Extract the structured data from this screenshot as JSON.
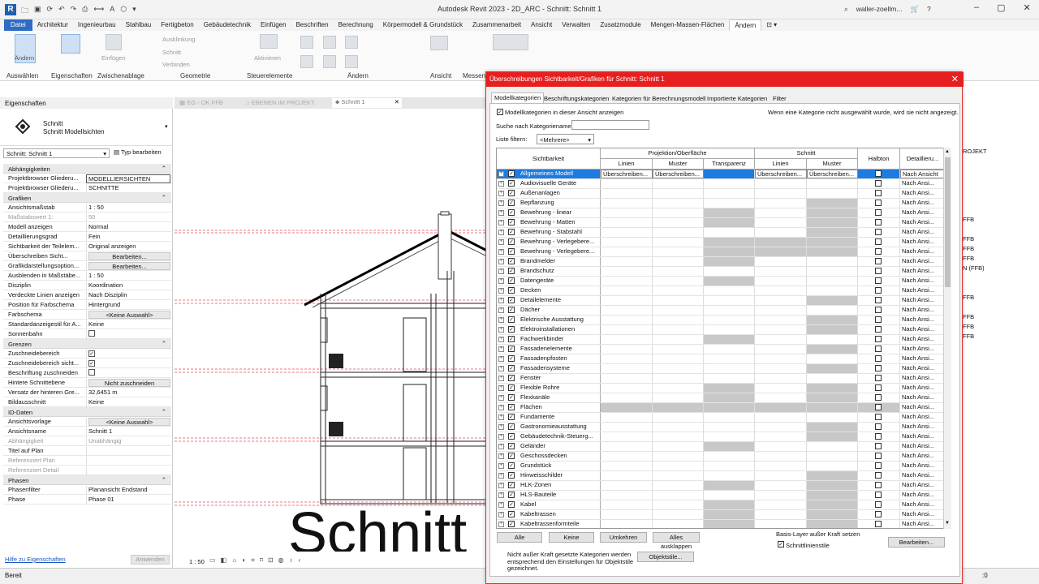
{
  "app": {
    "title": "Autodesk Revit 2023 - 2D_ARC - Schnitt: Schnitt 1",
    "user": "waller-zoellm...",
    "logo": "R"
  },
  "menu": [
    "Datei",
    "Architektur",
    "Ingenieurbau",
    "Stahlbau",
    "Fertigbeton",
    "Gebäudetechnik",
    "Einfügen",
    "Beschriften",
    "Berechnung",
    "Körpermodell & Grundstück",
    "Zusammenarbeit",
    "Ansicht",
    "Verwalten",
    "Zusatzmodule",
    "Mengen-Massen-Flächen",
    "Ändern"
  ],
  "ribbon": {
    "groups": [
      "Auswählen",
      "Eigenschaften",
      "Zwischenablage",
      "Geometrie",
      "Steuerelemente",
      "Ändern",
      "Ansicht",
      "Messen"
    ],
    "buttons": {
      "aendern": "Ändern",
      "einfuegen": "Einfügen",
      "ausklinkung": "Ausklinkung",
      "schnitt": "Schnitt",
      "verbinden": "Verbinden",
      "aktivieren": "Aktivieren"
    }
  },
  "properties": {
    "header": "Eigenschaften",
    "type_name": "Schnitt",
    "type_sub": "Schnitt Modellsichten",
    "instance": "Schnitt: Schnitt 1",
    "edit_type": "Typ bearbeiten",
    "help": "Hilfe zu Eigenschaften",
    "apply": "Anwenden",
    "sections": {
      "abh": "Abhängigkeiten",
      "grafiken": "Grafiken",
      "grenzen": "Grenzen",
      "iddaten": "ID-Daten",
      "phasen": "Phasen"
    },
    "rows": {
      "r1": {
        "k": "Projektbrowser Gliederu...",
        "v": "MODELLIERSICHTEN"
      },
      "r2": {
        "k": "Projektbrowser Gliederu...",
        "v": "SCHNITTE"
      },
      "r3": {
        "k": "Ansichtsmaßstab",
        "v": "1 : 50"
      },
      "r4": {
        "k": "Maßstabswert 1:",
        "v": "50"
      },
      "r5": {
        "k": "Modell anzeigen",
        "v": "Normal"
      },
      "r6": {
        "k": "Detaillierungsgrad",
        "v": "Fein"
      },
      "r7": {
        "k": "Sichtbarkeit der Teilelem...",
        "v": "Original anzeigen"
      },
      "r8": {
        "k": "Überschreiben Sicht...",
        "v": "Bearbeiten..."
      },
      "r9": {
        "k": "Grafikdarstellungsoption...",
        "v": "Bearbeiten..."
      },
      "r10": {
        "k": "Ausblenden in Maßstäbe...",
        "v": "1 : 50"
      },
      "r11": {
        "k": "Disziplin",
        "v": "Koordination"
      },
      "r12": {
        "k": "Verdeckte Linien anzeigen",
        "v": "Nach Disziplin"
      },
      "r13": {
        "k": "Position für Farbschema",
        "v": "Hintergrund"
      },
      "r14": {
        "k": "Farbschema",
        "v": "<Keine Auswahl>"
      },
      "r15": {
        "k": "Standardanzeigestil für A...",
        "v": "Keine"
      },
      "r16": {
        "k": "Sonnenbahn",
        "v": ""
      },
      "r17": {
        "k": "Zuschneidebereich",
        "v": "✓"
      },
      "r18": {
        "k": "Zuschneidebereich sicht...",
        "v": "✓"
      },
      "r19": {
        "k": "Beschriftung zuschneiden",
        "v": ""
      },
      "r20": {
        "k": "Hintere Schnittebene",
        "v": "Nicht zuschneiden"
      },
      "r21": {
        "k": "Versatz der hinteren Gre...",
        "v": "32,6451 m"
      },
      "r22": {
        "k": "Bildausschnitt",
        "v": "Keine"
      },
      "r23": {
        "k": "Ansichtsvorlage",
        "v": "<Keine Auswahl>"
      },
      "r24": {
        "k": "Ansichtsname",
        "v": "Schnitt 1"
      },
      "r25": {
        "k": "Abhängigkeit",
        "v": "Unabhängig"
      },
      "r26": {
        "k": "Titel auf Plan",
        "v": ""
      },
      "r27": {
        "k": "Referenziert Plan",
        "v": ""
      },
      "r28": {
        "k": "Referenziert Detail",
        "v": ""
      },
      "r29": {
        "k": "Phasenfilter",
        "v": "Planansicht Endstand"
      },
      "r30": {
        "k": "Phase",
        "v": "Phase 01"
      }
    }
  },
  "view_tabs": [
    "EG - OK FFB",
    "EBENEN IM PROJEKT",
    "Schnitt 1"
  ],
  "drawing": {
    "label": "Schnitt",
    "scale": "1 : 50"
  },
  "behind_text": [
    "ROJEKT",
    "FFB",
    "FFB",
    "FFB",
    "FFB",
    "N (FFB)",
    "FFB",
    "FFB",
    "FFB",
    "FFB"
  ],
  "status": "Bereit",
  "status_right": ":0",
  "dialog": {
    "title": "Überschreibungen Sichtbarkeit/Grafiken für Schnitt: Schnitt 1",
    "tabs": [
      "Modellkategorien",
      "Beschriftungskategorien",
      "Kategorien für Berechnungsmodell",
      "Importierte Kategorien",
      "Filter"
    ],
    "show_label": "Modellkategorien in dieser Ansicht anzeigen",
    "hint": "Wenn eine Kategorie nicht ausgewählt wurde, wird sie nicht angezeigt.",
    "search_label": "Suche nach Kategoriename:",
    "filter_label": "Liste filtern:",
    "filter_value": "<Mehrere>",
    "col_headers": {
      "sicht": "Sichtbarkeit",
      "proj": "Projektion/Oberfläche",
      "schnitt": "Schnitt",
      "linien": "Linien",
      "muster": "Muster",
      "transp": "Transparenz",
      "linien2": "Linien",
      "muster2": "Muster",
      "halbton": "Halbton",
      "detail": "Detaillieru..."
    },
    "override": "Überschreiben...",
    "nach_ansicht": "Nach Ansicht",
    "nach_ansi": "Nach Ansi...",
    "rows": [
      "Allgemeines Modell",
      "Audiovisuelle Geräte",
      "Außenanlagen",
      "Bepflanzung",
      "Bewehrung - linear",
      "Bewehrung - Matten",
      "Bewehrung - Stabstahl",
      "Bewehrung - Verlegebere...",
      "Bewehrung - Verlegebere...",
      "Brandmelder",
      "Brandschutz",
      "Datengeräte",
      "Decken",
      "Detailelemente",
      "Dächer",
      "Elektrische Ausstattung",
      "Elektroinstallationen",
      "Fachwerkbinder",
      "Fassadenelemente",
      "Fassadenpfosten",
      "Fassadensysteme",
      "Fenster",
      "Flexible Rohre",
      "Flexkanäle",
      "Flächen",
      "Fundamente",
      "Gastronomieausstattung",
      "Gebäudetechnik-Steuerg...",
      "Geländer",
      "Geschossdecken",
      "Grundstück",
      "Hinweisschilder",
      "HLK-Zonen",
      "HLS-Bauteile",
      "Kabel",
      "Kabeltrassen",
      "Kabeltrassenformteile"
    ],
    "grey": [
      [],
      [],
      [],
      [
        4,
        5
      ],
      [
        2,
        4,
        5
      ],
      [
        2,
        4,
        5
      ],
      [
        4,
        5
      ],
      [
        2,
        3,
        4,
        5
      ],
      [
        2,
        3,
        4,
        5
      ],
      [
        2
      ],
      [],
      [
        2
      ],
      [],
      [
        4,
        5
      ],
      [],
      [
        4,
        5
      ],
      [
        4,
        5
      ],
      [
        2
      ],
      [
        4,
        5
      ],
      [],
      [
        4,
        5
      ],
      [],
      [
        2,
        4,
        5
      ],
      [
        2,
        4,
        5
      ],
      [
        0,
        1,
        2,
        3,
        4,
        5
      ],
      [],
      [
        4,
        5
      ],
      [
        4,
        5
      ],
      [
        2
      ],
      [],
      [],
      [
        4,
        5
      ],
      [
        2,
        4,
        5
      ],
      [
        4,
        5
      ],
      [
        2,
        4,
        5
      ],
      [
        2,
        4,
        5
      ],
      [
        2,
        4,
        5
      ]
    ],
    "buttons": {
      "alle": "Alle",
      "keine": "Keine",
      "umkehren": "Umkehren",
      "ausklappen": "Alles ausklappen",
      "bearbeiten": "Bearbeiten...",
      "objektstile": "Objektstile..."
    },
    "basis_label": "Basis-Layer außer Kraft setzen",
    "schnittlinien": "Schnittlinienstile",
    "note": "Nicht außer Kraft gesetzte Kategorien werden entsprechend den Einstellungen für Objektstile gezeichnet."
  }
}
